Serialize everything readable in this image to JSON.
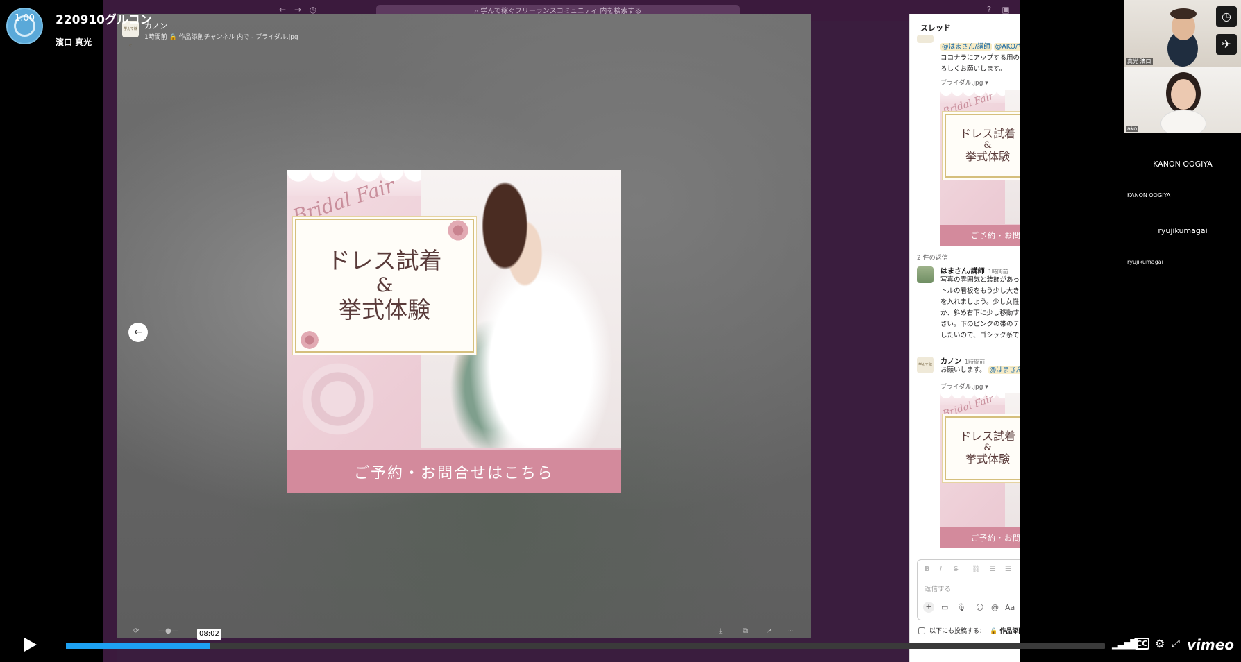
{
  "vimeo": {
    "speed_badge": "1.00",
    "title": "220910グルコン",
    "owner": "濱口 真光",
    "current_time": "08:02",
    "progress_fraction": 0.139,
    "logo": "vimeo",
    "icons": [
      "play-icon",
      "volume-icon",
      "cc-icon",
      "settings-icon",
      "fullscreen-icon",
      "clock-icon",
      "send-icon"
    ]
  },
  "slack": {
    "search_placeholder": "学んで稼ぐフリーランスコミュニティ 内を検索する",
    "viewer": {
      "sender": "カノン",
      "meta": "1時間前 🔒 作品添削チャンネル 内で - ブライダル.jpg"
    },
    "banner": {
      "script_text": "Bridal Fair",
      "line1": "ドレス試着",
      "line2": "&",
      "line3": "挙式体験",
      "cta": "ご予約・お問合せはこちら"
    },
    "thread": {
      "title": "スレッド",
      "close": "×",
      "first_message": {
        "mention1": "@はまさん/講師",
        "mention2": "@AKO/サポーター",
        "text": "ココナラにアップする用のバナーを制作しました。よろしくお願いします。",
        "file": "ブライダル.jpg ▾"
      },
      "replies_count": "2 件の返信",
      "reply1": {
        "name": "はまさん/講師",
        "time": "1時間前",
        "text": "写真の雰囲気と装飾があってていい感じですね。タイトルの看板をもう少し大きくしてタイトルの回に余白を入れましょう。少し女性の画像サイズを小さくするか、斜め右下に少し移動する感じで調整してみてください。下のピンクの帯のテキストはタイトルと差を出したいので、ゴシック系で入れてみましょう。"
      },
      "reply2": {
        "name": "カノン",
        "time": "1時間前",
        "text": "お願いします。",
        "mention": "@はまさん/講師",
        "file": "ブライダル.jpg ▾"
      },
      "composer_placeholder": "返信する...",
      "also_post": "以下にも投稿する：",
      "also_post_channel": "🔒 作品添削チャンネル",
      "avatar_label": "学んで稼ぐ"
    }
  },
  "participants": [
    {
      "name": "真光 濱口",
      "has_video": true
    },
    {
      "name": "ako",
      "has_video": true
    },
    {
      "name": "KANON OOGIYA",
      "center": "KANON OOGIYA",
      "has_video": false
    },
    {
      "name": "ryujikumagai",
      "center": "ryujikumagai",
      "has_video": false
    }
  ],
  "colors": {
    "slack_aubergine": "#3b1a3d",
    "cta_pink": "#d38a9c",
    "progress_blue": "#1da1f2",
    "mention_bg": "#f8ecc6"
  }
}
